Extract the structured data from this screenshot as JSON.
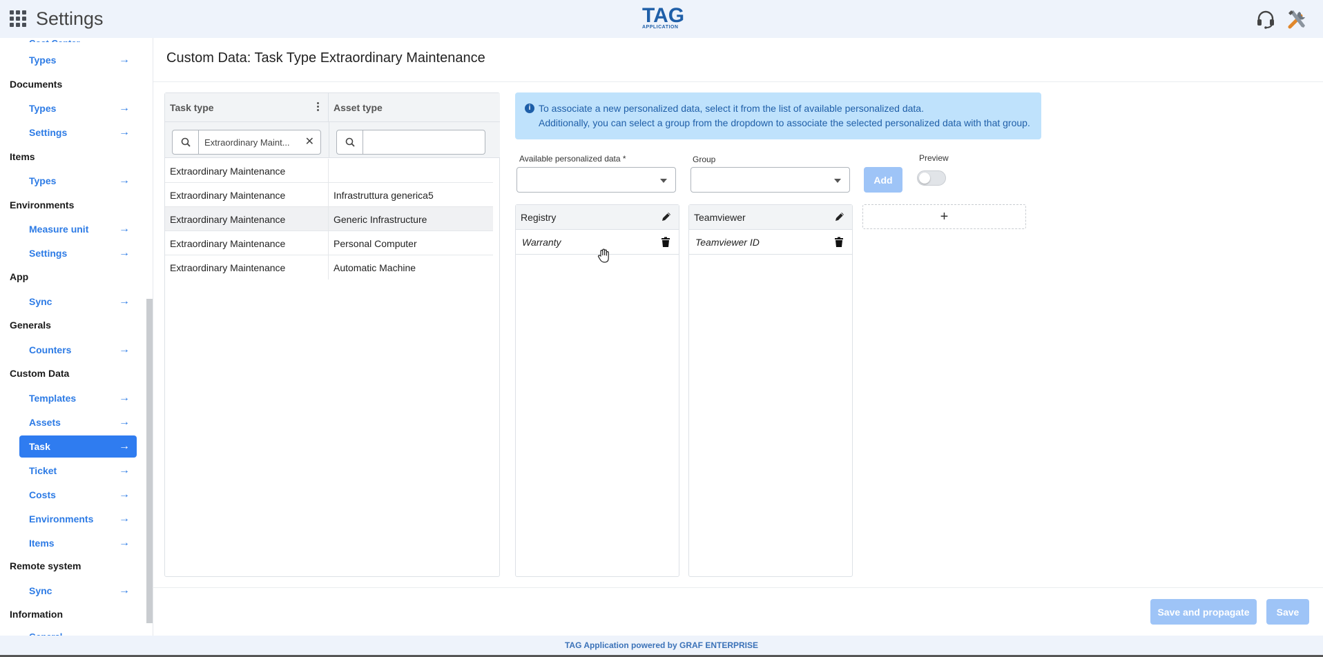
{
  "header": {
    "title": "Settings",
    "logo_main": "TAG",
    "logo_sub": "APPLICATION"
  },
  "sidebar": {
    "top_cut": "Cost Center",
    "bottom_cut": "General",
    "sections": [
      {
        "title": "",
        "items": [
          {
            "label": "Types"
          }
        ]
      },
      {
        "title": "Documents",
        "items": [
          {
            "label": "Types"
          },
          {
            "label": "Settings"
          }
        ]
      },
      {
        "title": "Items",
        "items": [
          {
            "label": "Types"
          }
        ]
      },
      {
        "title": "Environments",
        "items": [
          {
            "label": "Measure unit"
          },
          {
            "label": "Settings"
          }
        ]
      },
      {
        "title": "App",
        "items": [
          {
            "label": "Sync"
          }
        ]
      },
      {
        "title": "Generals",
        "items": [
          {
            "label": "Counters"
          }
        ]
      },
      {
        "title": "Custom Data",
        "items": [
          {
            "label": "Templates"
          },
          {
            "label": "Assets"
          },
          {
            "label": "Task"
          },
          {
            "label": "Ticket"
          },
          {
            "label": "Costs"
          },
          {
            "label": "Environments"
          },
          {
            "label": "Items"
          }
        ]
      },
      {
        "title": "Remote system",
        "items": [
          {
            "label": "Sync"
          }
        ]
      },
      {
        "title": "Information",
        "items": []
      }
    ],
    "arrow": "→"
  },
  "main": {
    "title": "Custom Data: Task Type Extraordinary Maintenance",
    "table": {
      "col1": "Task type",
      "col2": "Asset type",
      "filter1_value": "Extraordinary Maint...",
      "filter2_value": "",
      "rows": [
        [
          "Extraordinary Maintenance",
          ""
        ],
        [
          "Extraordinary Maintenance",
          "Infrastruttura generica5"
        ],
        [
          "Extraordinary Maintenance",
          "Generic Infrastructure"
        ],
        [
          "Extraordinary Maintenance",
          "Personal Computer"
        ],
        [
          "Extraordinary Maintenance",
          "Automatic Machine"
        ]
      ]
    },
    "info": {
      "line1": "To associate a new personalized data, select it from the list of available personalized data.",
      "line2": "Additionally, you can select a group from the dropdown to associate the selected personalized data with that group."
    },
    "form": {
      "available_label": "Available personalized data *",
      "available_value": "",
      "group_label": "Group",
      "group_value": "",
      "add_label": "Add",
      "preview_label": "Preview",
      "preview_on": false
    },
    "groups": [
      {
        "name": "Registry",
        "items": [
          "Warranty"
        ]
      },
      {
        "name": "Teamviewer",
        "items": [
          "Teamviewer ID"
        ]
      }
    ],
    "add_group_symbol": "+"
  },
  "actions": {
    "save_propagate": "Save and propagate",
    "save": "Save"
  },
  "footer": {
    "text": "TAG Application powered by GRAF ENTERPRISE"
  },
  "colors": {
    "accent": "#2f7cf0",
    "link": "#2d7be5",
    "disabled_button": "#9ec4f7",
    "info_bg": "#bfe2fc",
    "header_bg": "#eef3fb"
  }
}
